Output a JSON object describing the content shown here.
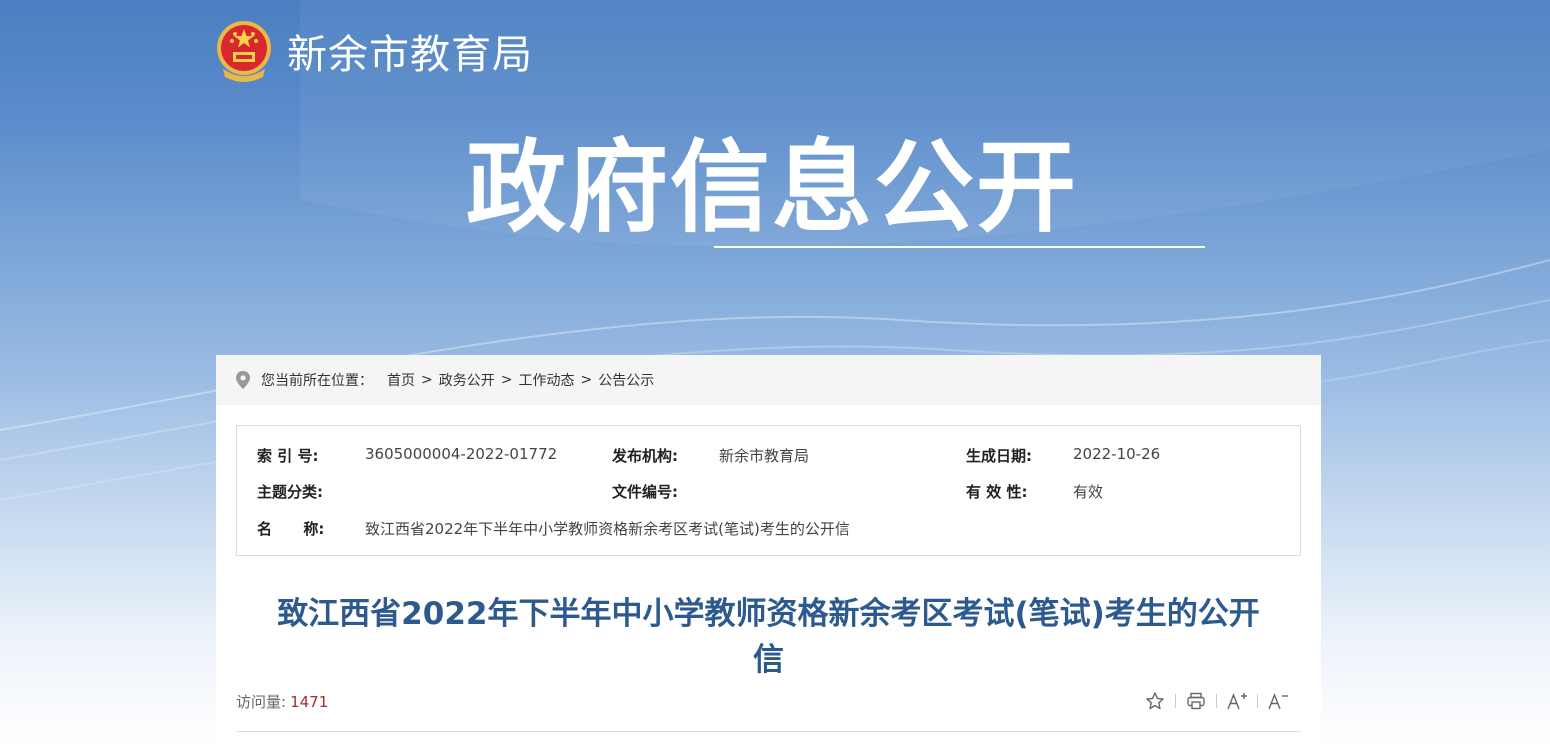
{
  "site": {
    "name": "新余市教育局"
  },
  "banner": {
    "title": "政府信息公开"
  },
  "breadcrumb": {
    "label": "您当前所在位置：",
    "items": [
      "首页",
      "政务公开",
      "工作动态",
      "公告公示"
    ],
    "separator": ">"
  },
  "meta": {
    "index_label": "索 引 号:",
    "index_value": "3605000004-2022-01772",
    "publisher_label": "发布机构:",
    "publisher_value": "新余市教育局",
    "date_label": "生成日期:",
    "date_value": "2022-10-26",
    "topic_label": "主题分类:",
    "topic_value": "",
    "docno_label": "文件编号:",
    "docno_value": "",
    "validity_label": "有 效 性:",
    "validity_value": "有效",
    "name_label": "名      称:",
    "name_value": "致江西省2022年下半年中小学教师资格新余考区考试(笔试)考生的公开信"
  },
  "article": {
    "title_line1": "致江西省2022年下半年中小学教师资格新余考区考试(笔试)考生的公开",
    "title_line2": "信",
    "visits_label": "访问量:",
    "visits_value": "1471"
  },
  "tools": [
    "star-icon",
    "print-icon",
    "font-increase-icon",
    "font-decrease-icon"
  ],
  "colors": {
    "title": "#2d5a8e",
    "visits": "#a0302b",
    "banner_top": "#4a7fc1"
  }
}
